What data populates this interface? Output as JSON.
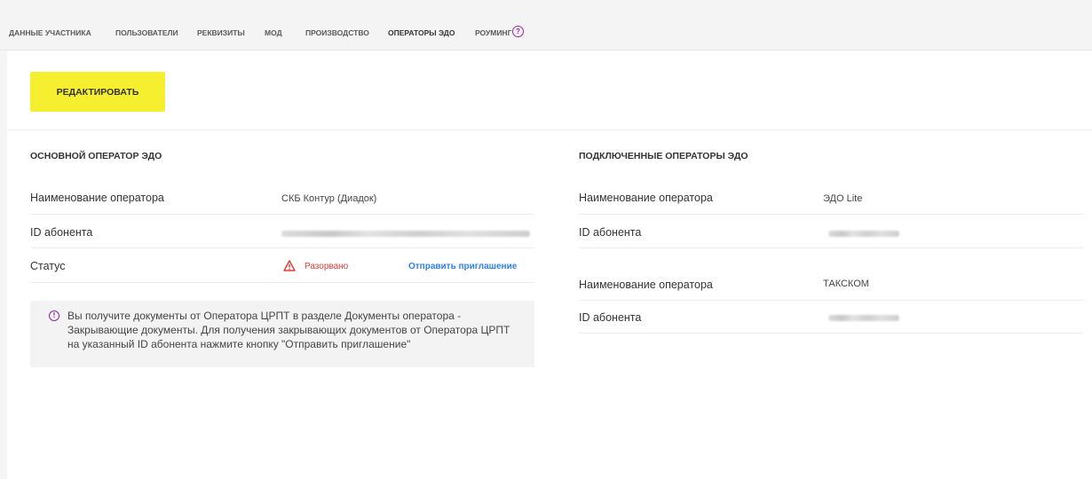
{
  "tabs": [
    {
      "label": "Данные участника"
    },
    {
      "label": "Пользователи"
    },
    {
      "label": "Реквизиты"
    },
    {
      "label": "МОД"
    },
    {
      "label": "Производство"
    },
    {
      "label": "Операторы ЭДО"
    },
    {
      "label": "Роуминг"
    }
  ],
  "active_tab": "Операторы ЭДО",
  "help_icon_glyph": "?",
  "edit_button": {
    "label": "РЕДАКТИРОВАТЬ"
  },
  "main_operator": {
    "title": "ОСНОВНОЙ ОПЕРАТОР ЭДО",
    "operator_label": "Наименование оператора",
    "operator_value": "СКБ Контур (Диадок)",
    "subscriber_label": "ID абонента",
    "status_label": "Статус",
    "status_value": "Разорвано",
    "invite_link": "Отправить приглашение"
  },
  "info": {
    "icon_glyph": "!",
    "text": "Вы получите документы от Оператора ЦРПТ в разделе Документы оператора - Закрывающие документы. Для получения закрывающих документов от Оператора ЦРПТ на указанный ID абонента нажмите кнопку \"Отправить приглашение\""
  },
  "connected_operators": {
    "title": "ПОДКЛЮЧЕННЫЕ ОПЕРАТОРЫ ЭДО",
    "items": [
      {
        "operator_label": "Наименование оператора",
        "operator_value": "ЭДО Lite",
        "subscriber_label": "ID абонента"
      },
      {
        "operator_label": "Наименование оператора",
        "operator_value": "ТАКСКОМ",
        "subscriber_label": "ID абонента"
      }
    ]
  },
  "colors": {
    "accent_yellow": "#f6ef2f",
    "status_red": "#e53935",
    "link_blue": "#2f80ed",
    "help_purple": "#9c27b0"
  }
}
